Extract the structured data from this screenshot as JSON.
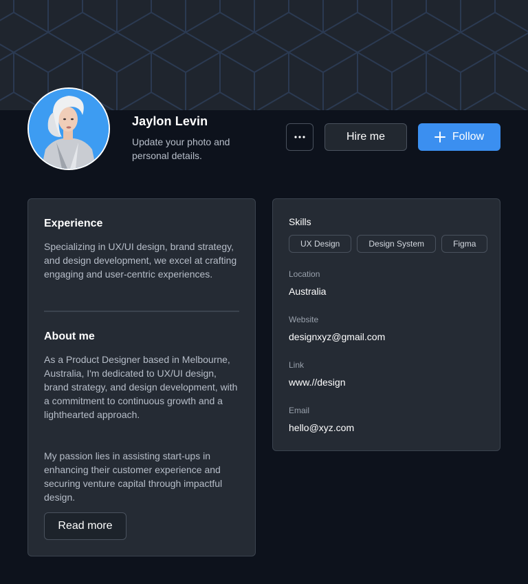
{
  "profile": {
    "name": "Jaylon Levin",
    "subtitle": "Update your photo and personal details."
  },
  "actions": {
    "more_icon": "more-horizontal-icon",
    "hire_label": "Hire me",
    "follow_label": "Follow",
    "follow_icon": "plus-icon"
  },
  "experience": {
    "title": "Experience",
    "text": "Specializing in UX/UI design, brand strategy, and design development, we excel at crafting engaging and user-centric experiences."
  },
  "about": {
    "title": "About me",
    "paragraph1": "As a Product Designer based in Melbourne, Australia, I'm dedicated to UX/UI design, brand strategy, and design development, with a commitment to continuous growth and a lighthearted approach.",
    "paragraph2": "My passion lies in assisting start-ups in enhancing their customer experience and securing venture capital through impactful design.",
    "read_more_label": "Read more"
  },
  "details": {
    "skills_label": "Skills",
    "skills": [
      "UX Design",
      "Design System",
      "Figma"
    ],
    "location_label": "Location",
    "location": "Australia",
    "website_label": "Website",
    "website": "designxyz@gmail.com",
    "link_label": "Link",
    "link": "www.//design",
    "email_label": "Email",
    "email": "hello@xyz.com"
  },
  "colors": {
    "background": "#0d121c",
    "card": "#252b34",
    "accent": "#3b8ff0",
    "avatar_bg": "#3d9cf2"
  }
}
